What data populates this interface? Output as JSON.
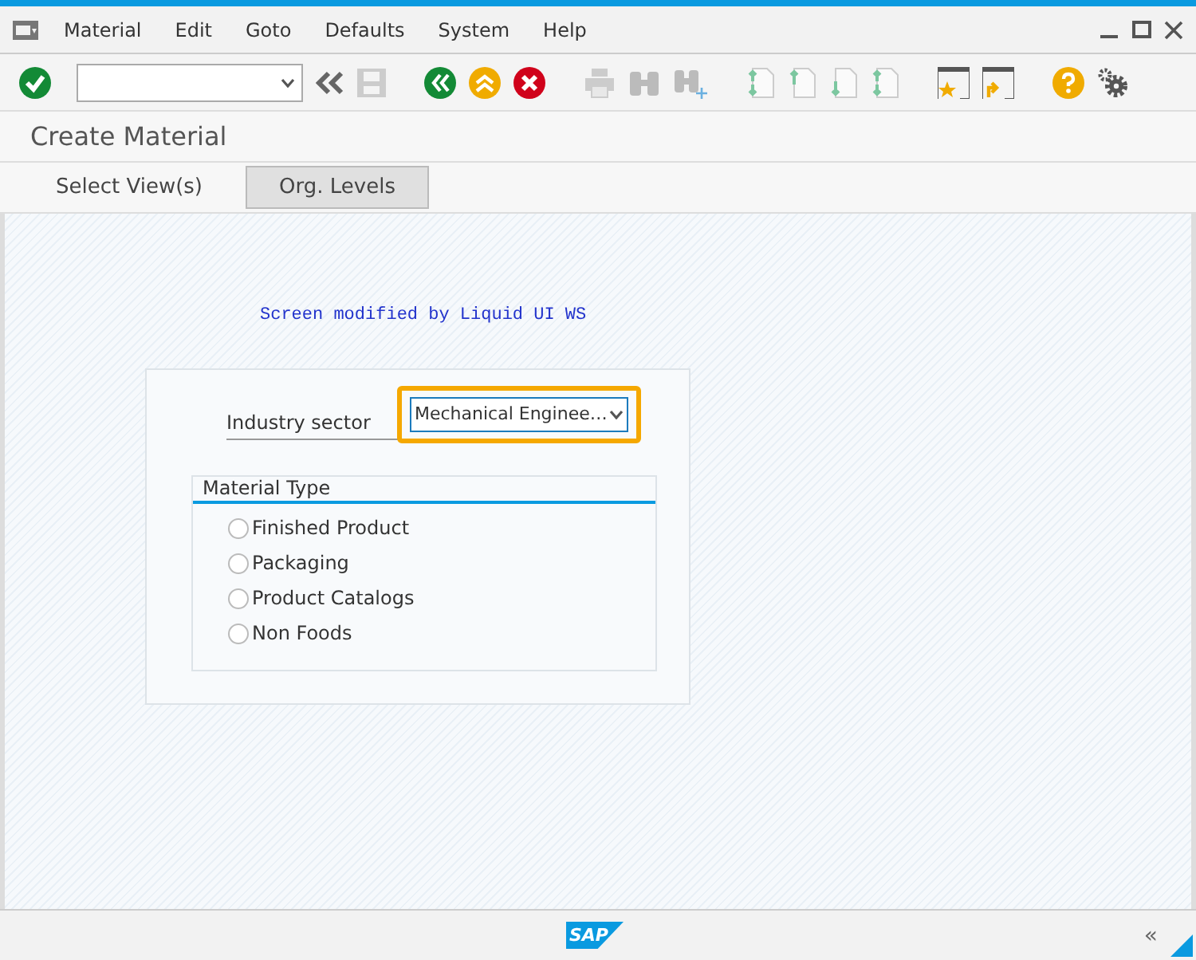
{
  "menu_bar": {
    "items": [
      {
        "label": "Material"
      },
      {
        "label": "Edit"
      },
      {
        "label": "Goto"
      },
      {
        "label": "Defaults"
      },
      {
        "label": "System"
      },
      {
        "label": "Help"
      }
    ]
  },
  "screen_title": "Create Material",
  "tabs": [
    {
      "label": "Select View(s)",
      "selected": false
    },
    {
      "label": "Org. Levels",
      "selected": true
    }
  ],
  "note": "Screen modified by Liquid UI WS",
  "industry_sector": {
    "label": "Industry sector",
    "value": "Mechanical Enginee…",
    "highlighted": true
  },
  "material_type": {
    "title": "Material Type",
    "options": [
      {
        "label": "Finished Product",
        "selected": false
      },
      {
        "label": "Packaging",
        "selected": false
      },
      {
        "label": "Product Catalogs",
        "selected": false
      },
      {
        "label": "Non Foods",
        "selected": false
      }
    ]
  },
  "status_bar": {
    "logo": "SAP",
    "collapse": "«"
  }
}
